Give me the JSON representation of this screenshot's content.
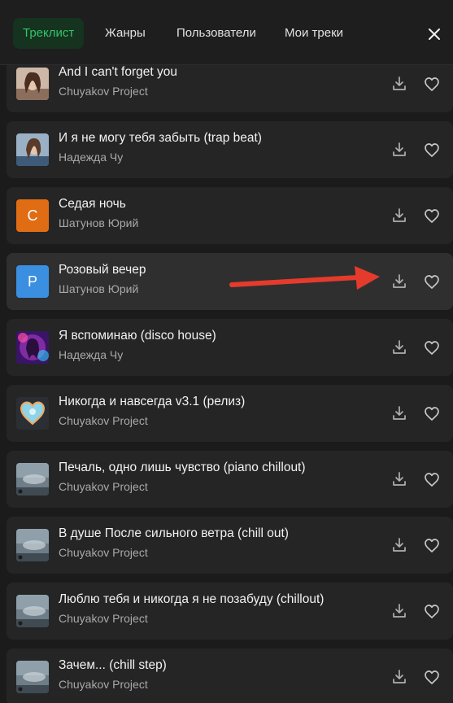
{
  "tabs": [
    {
      "label": "Треклист",
      "active": true
    },
    {
      "label": "Жанры",
      "active": false
    },
    {
      "label": "Пользователи",
      "active": false
    },
    {
      "label": "Мои треки",
      "active": false
    }
  ],
  "close_icon": "close-icon",
  "colors": {
    "accent": "#34c46a",
    "annotation_arrow": "#e53b2c",
    "cover_c": "#e06d14",
    "cover_p": "#3b8fe0"
  },
  "tracks": [
    {
      "title": "And I can't forget you",
      "artist": "Chuyakov Project",
      "cover": "photo-woman"
    },
    {
      "title": "И я не могу тебя забыть (trap beat)",
      "artist": "Надежда Чу",
      "cover": "photo-woman"
    },
    {
      "title": "Седая ночь",
      "artist": "Шатунов Юрий",
      "cover": "letter",
      "cover_letter": "С"
    },
    {
      "title": "Розовый вечер",
      "artist": "Шатунов Юрий",
      "cover": "letter",
      "cover_letter": "Р"
    },
    {
      "title": "Я вспоминаю (disco house)",
      "artist": "Надежда Чу",
      "cover": "art-neon"
    },
    {
      "title": "Никогда и навсегда v3.1 (релиз)",
      "artist": "Chuyakov Project",
      "cover": "art-heart"
    },
    {
      "title": "Печаль, одно лишь чувство (piano chillout)",
      "artist": "Chuyakov Project",
      "cover": "art-sky"
    },
    {
      "title": "В душе После сильного ветра (chill out)",
      "artist": "Chuyakov Project",
      "cover": "art-sky"
    },
    {
      "title": "Люблю тебя и никогда я не позабуду (chillout)",
      "artist": "Chuyakov Project",
      "cover": "art-sky"
    },
    {
      "title": "Зачем... (chill step)",
      "artist": "Chuyakov Project",
      "cover": "art-sky"
    }
  ],
  "row_icons": {
    "download": "download-icon",
    "like": "heart-icon"
  }
}
